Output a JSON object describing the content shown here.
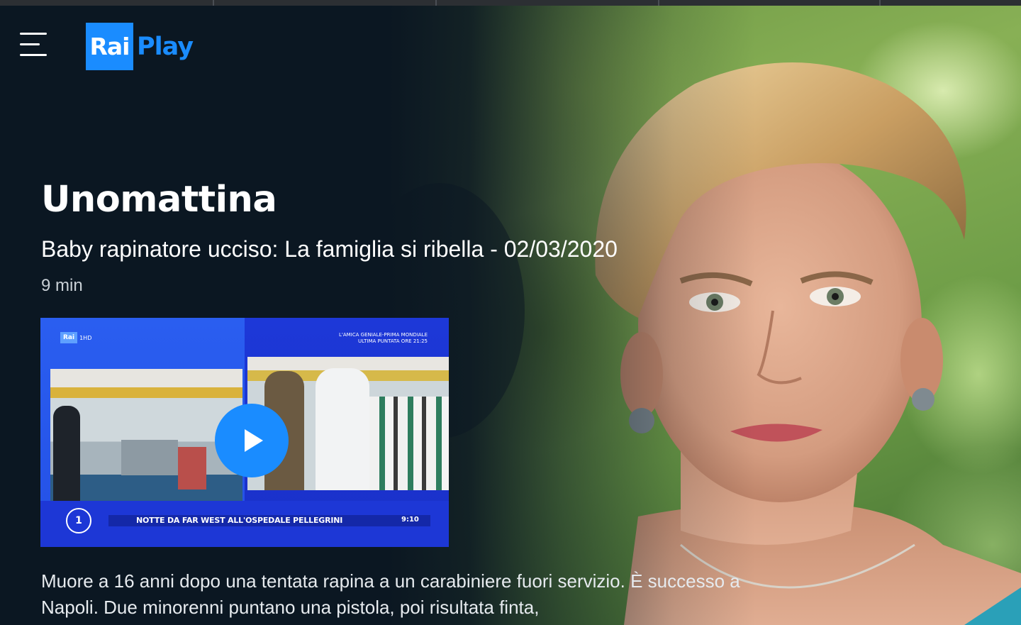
{
  "window": {
    "title": "RaiPlay"
  },
  "header": {
    "menu_icon": "hamburger-menu-icon",
    "logo": {
      "part1": "Rai",
      "part2": "Play",
      "brand_color": "#1a8cff"
    }
  },
  "program": {
    "show_title": "Unomattina",
    "episode_title": "Baby rapinatore ucciso: La famiglia si ribella - 02/03/2020",
    "duration": "9 min",
    "description": "Muore a 16 anni dopo una tentata rapina a un carabiniere fuori servizio. È successo a Napoli. Due minorenni puntano una pistola, poi risultata finta,"
  },
  "thumbnail": {
    "channel_badge": "Rai",
    "channel_badge_suffix": "1HD",
    "promo_line1": "L'AMICA GENIALE-PRIMA MONDIALE",
    "promo_line2": "ULTIMA PUNTATA ORE 21:25",
    "channel_number": "1",
    "caption": "NOTTE DA FAR WEST ALL'OSPEDALE PELLEGRINI",
    "clock": "9:10",
    "play_icon": "play-icon"
  },
  "colors": {
    "background": "#0b1722",
    "accent": "#1a8cff",
    "text_secondary": "#c9d0d6"
  }
}
